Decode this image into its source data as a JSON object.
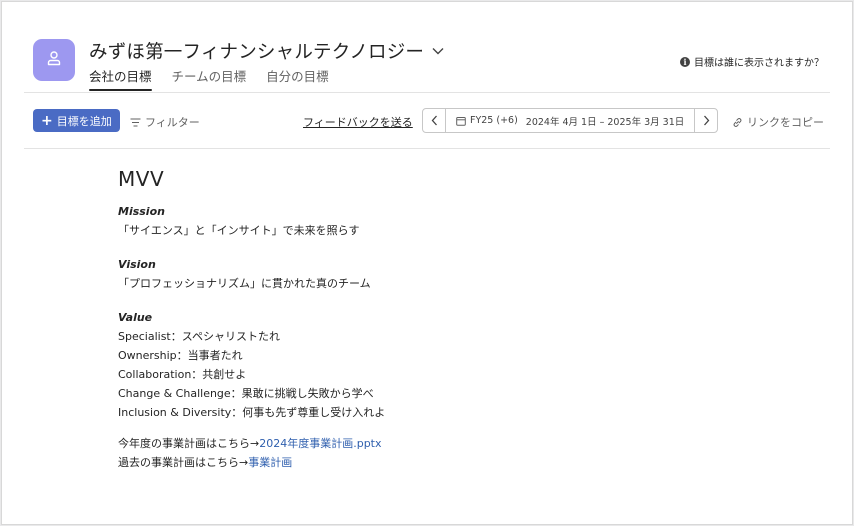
{
  "header": {
    "org_name": "みずほ第一フィナンシャルテクノロジー",
    "tabs": [
      {
        "label": "会社の目標",
        "active": true
      },
      {
        "label": "チームの目標",
        "active": false
      },
      {
        "label": "自分の目標",
        "active": false
      }
    ],
    "who_sees_text": "目標は誰に表示されますか？"
  },
  "toolbar": {
    "add_label": "目標を追加",
    "filter_label": "フィルター",
    "feedback_label": "フィードバックを送る",
    "period_fy": "FY25 (+6)",
    "period_range": "2024年 4月 1日 – 2025年 3月 31日",
    "copy_link_label": "リンクをコピー"
  },
  "content": {
    "title": "MVV",
    "mission_heading": "Mission",
    "mission_text": "「サイエンス」と「インサイト」で未来を照らす",
    "vision_heading": "Vision",
    "vision_text": "「プロフェッショナリズム」に貫かれた真のチーム",
    "value_heading": "Value",
    "values": [
      "Specialist：スペシャリストたれ",
      "Ownership：当事者たれ",
      "Collaboration：共創せよ",
      "Change & Challenge：果敢に挑戦し失敗から学べ",
      "Inclusion & Diversity：何事も先ず尊重し受け入れよ"
    ],
    "plan_current_prefix": "今年度の事業計画はこちら→",
    "plan_current_link": "2024年度事業計画.pptx",
    "plan_past_prefix": "過去の事業計画はこちら→",
    "plan_past_link": "事業計画"
  },
  "colors": {
    "avatar_bg": "#9d98f0",
    "primary_button": "#4a6bc4",
    "link": "#2f5fae"
  },
  "icons": [
    "person-icon",
    "chevron-down-icon",
    "info-icon",
    "plus-icon",
    "filter-icon",
    "chevron-left-icon",
    "calendar-icon",
    "chevron-right-icon",
    "link-icon"
  ]
}
